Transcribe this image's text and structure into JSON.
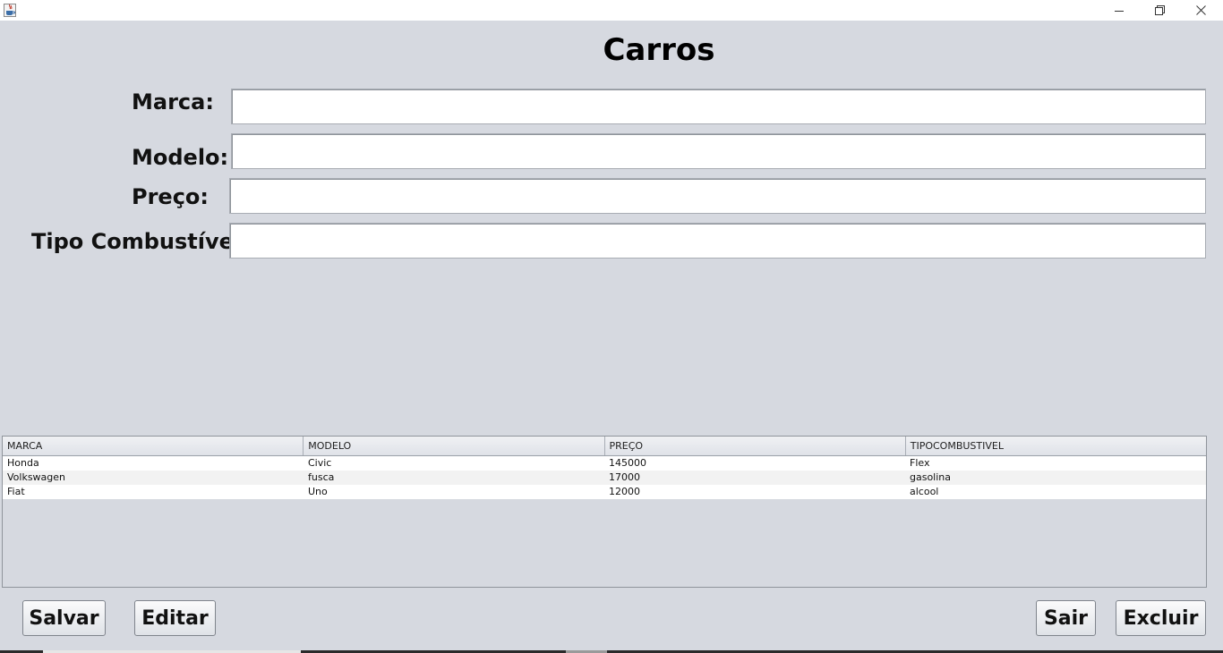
{
  "window": {
    "controls": {
      "minimize_icon": "minimize-icon",
      "restore_icon": "restore-icon",
      "close_icon": "close-icon"
    }
  },
  "form": {
    "title": "Carros",
    "fields": {
      "marca": {
        "label": "Marca:",
        "value": ""
      },
      "modelo": {
        "label": "Modelo:",
        "value": ""
      },
      "preco": {
        "label": "Preço:",
        "value": ""
      },
      "tipo": {
        "label": "Tipo Combustível:",
        "value": ""
      }
    }
  },
  "table": {
    "columns": [
      "MARCA",
      "MODELO",
      "PREÇO",
      "TIPOCOMBUSTIVEL"
    ],
    "rows": [
      [
        "Honda",
        "Civic",
        "145000",
        "Flex"
      ],
      [
        "Volkswagen",
        "fusca",
        "17000",
        "gasolina"
      ],
      [
        "Fiat",
        "Uno",
        "12000",
        "alcool"
      ]
    ]
  },
  "buttons": {
    "salvar": "Salvar",
    "editar": "Editar",
    "sair": "Sair",
    "excluir": "Excluir"
  },
  "colors": {
    "background": "#d6d9e0",
    "field_background": "#ffffff",
    "row_alt": "#f2f2f2"
  }
}
